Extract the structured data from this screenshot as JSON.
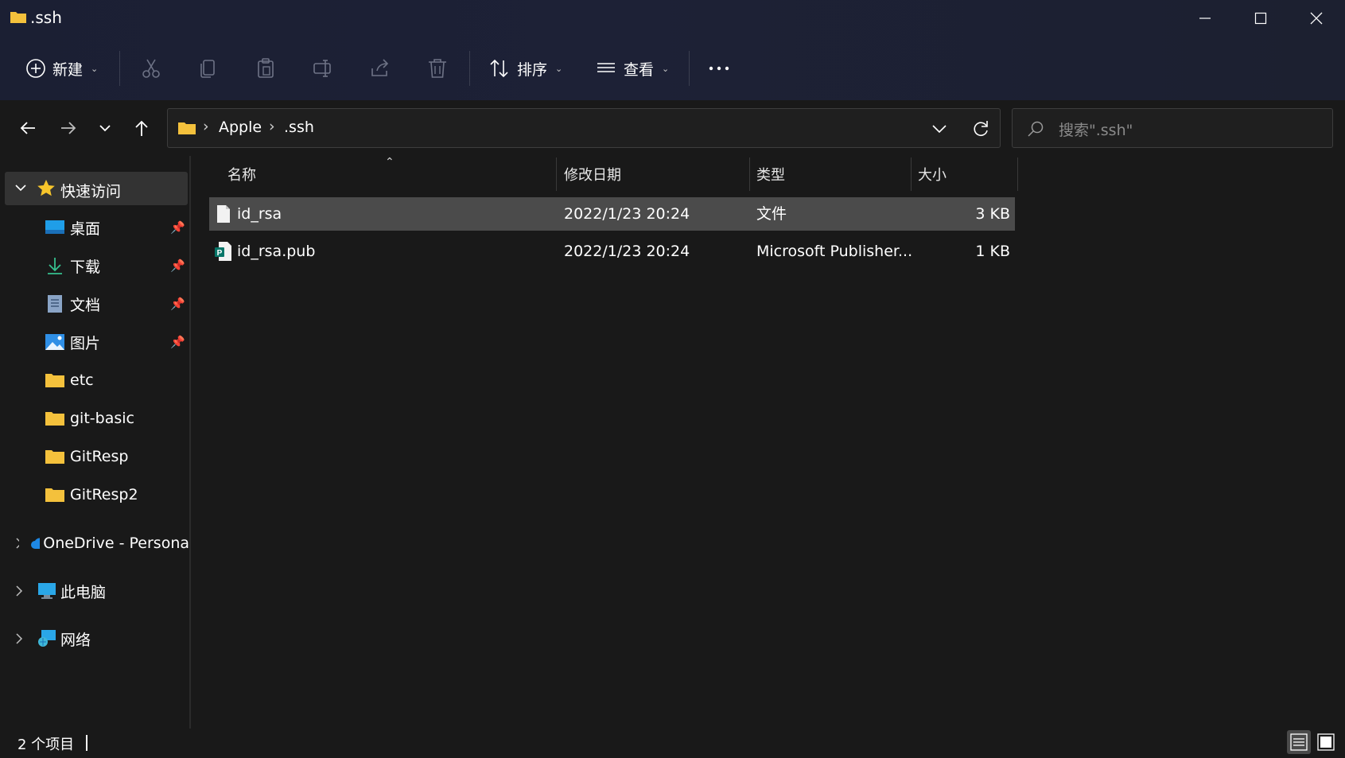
{
  "window": {
    "title": ".ssh",
    "controls": [
      "minimize-icon",
      "maximize-icon",
      "close-icon"
    ]
  },
  "toolbar": {
    "new_label": "新建",
    "sort_label": "排序",
    "view_label": "查看",
    "icons": [
      "cut-icon",
      "copy-icon",
      "paste-icon",
      "rename-icon",
      "share-icon",
      "delete-icon",
      "more-icon"
    ]
  },
  "address": {
    "segments": [
      "Apple",
      ".ssh"
    ]
  },
  "search": {
    "placeholder": "搜索\".ssh\""
  },
  "sidebar": {
    "quick_access": "快速访问",
    "items": [
      {
        "label": "桌面",
        "icon": "desktop-icon",
        "pinned": true
      },
      {
        "label": "下载",
        "icon": "download-icon",
        "pinned": true
      },
      {
        "label": "文档",
        "icon": "documents-icon",
        "pinned": true
      },
      {
        "label": "图片",
        "icon": "pictures-icon",
        "pinned": true
      },
      {
        "label": "etc",
        "icon": "folder-icon",
        "pinned": false
      },
      {
        "label": "git-basic",
        "icon": "folder-icon",
        "pinned": false
      },
      {
        "label": "GitResp",
        "icon": "folder-icon",
        "pinned": false
      },
      {
        "label": "GitResp2",
        "icon": "folder-icon",
        "pinned": false
      }
    ],
    "onedrive": "OneDrive - Persona",
    "this_pc": "此电脑",
    "network": "网络"
  },
  "columns": {
    "name": "名称",
    "modified": "修改日期",
    "type": "类型",
    "size": "大小"
  },
  "files": [
    {
      "name": "id_rsa",
      "modified": "2022/1/23 20:24",
      "type": "文件",
      "size": "3 KB",
      "icon": "file-icon"
    },
    {
      "name": "id_rsa.pub",
      "modified": "2022/1/23 20:24",
      "type": "Microsoft Publisher...",
      "size": "1 KB",
      "icon": "publisher-file-icon"
    }
  ],
  "status": {
    "item_count": "2 个项目"
  },
  "colors": {
    "background": "#191919",
    "toolbar": "#1c2033",
    "selection": "#4b4b4b",
    "folder": "#f4c13c"
  }
}
